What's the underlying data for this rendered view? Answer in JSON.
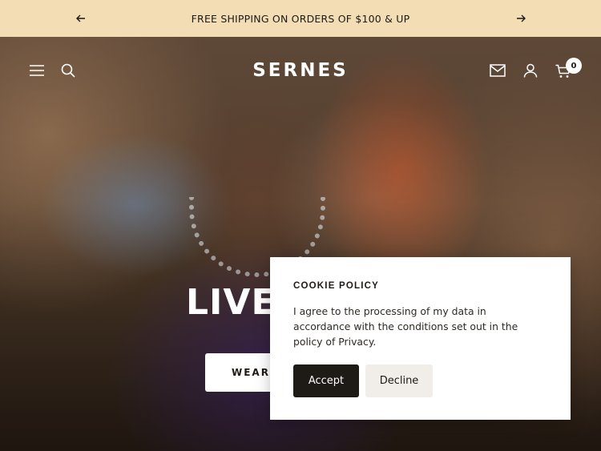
{
  "announcement": {
    "text": "FREE SHIPPING ON ORDERS OF $100 & UP",
    "prev_icon": "arrow-left-icon",
    "next_icon": "arrow-right-icon",
    "background": "#f2ddb5"
  },
  "header": {
    "logo": "SERNES",
    "icons": [
      "menu-icon",
      "search-icon",
      "mail-icon",
      "account-icon",
      "cart-icon"
    ],
    "cart_count": "0"
  },
  "hero": {
    "title": "LIVE",
    "button_label": "WEAR T"
  },
  "cookie": {
    "title": "COOKIE POLICY",
    "text": "I agree to the processing of my data in accordance with the conditions set out in the policy of Privacy.",
    "accept_label": "Accept",
    "decline_label": "Decline",
    "accept_color": "#1e1a16",
    "decline_color": "#f1ede8"
  }
}
